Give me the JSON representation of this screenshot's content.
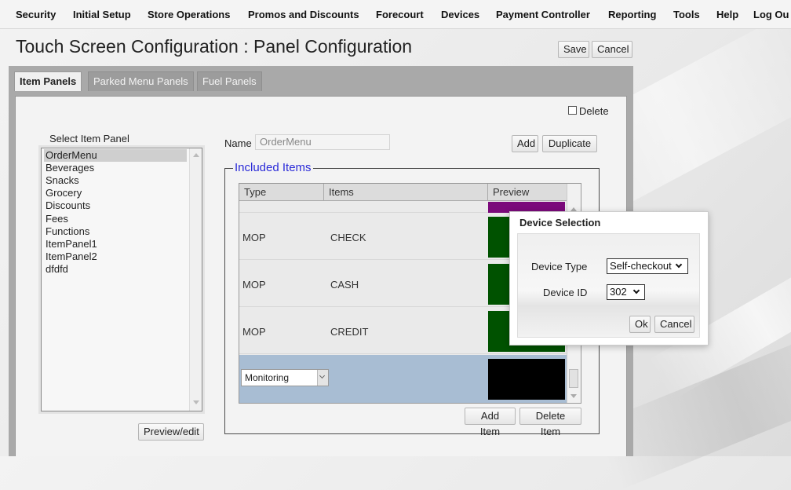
{
  "nav": {
    "items": [
      "Security",
      "Initial Setup",
      "Store Operations",
      "Promos and Discounts",
      "Forecourt",
      "Devices",
      "Payment Controller",
      "Reporting",
      "Tools",
      "Help",
      "Log Ou"
    ]
  },
  "page": {
    "title": "Touch Screen Configuration : Panel Configuration",
    "save_label": "Save",
    "cancel_label": "Cancel"
  },
  "tabs": [
    "Item Panels",
    "Parked Menu Panels",
    "Fuel Panels"
  ],
  "panel": {
    "delete_label": "Delete",
    "select_label": "Select Item Panel",
    "items": [
      "OrderMenu",
      "Beverages",
      "Snacks",
      "Grocery",
      "Discounts",
      "Fees",
      "Functions",
      "ItemPanel1",
      "ItemPanel2",
      "dfdfd"
    ],
    "selected_item": "OrderMenu",
    "preview_edit_label": "Preview/edit",
    "name_label": "Name",
    "name_value": "OrderMenu",
    "add_label": "Add",
    "duplicate_label": "Duplicate",
    "included_items_legend": "Included Items",
    "grid": {
      "headers": [
        "Type",
        "Items",
        "Preview"
      ],
      "rows": [
        {
          "type": "MOP",
          "item": "CHECK",
          "color": "#005200"
        },
        {
          "type": "MOP",
          "item": "CASH",
          "color": "#005200"
        },
        {
          "type": "MOP",
          "item": "CREDIT",
          "color": "#005200"
        }
      ],
      "partial_row_color": "#7b0a7b",
      "edit_row": {
        "type_value": "Monitoring",
        "color": "#000000"
      }
    },
    "add_item_label": "Add Item",
    "delete_item_label": "Delete Item"
  },
  "dialog": {
    "title": "Device Selection",
    "device_type_label": "Device Type",
    "device_type_value": "Self-checkout",
    "device_id_label": "Device ID",
    "device_id_value": "302",
    "ok_label": "Ok",
    "cancel_label": "Cancel"
  }
}
